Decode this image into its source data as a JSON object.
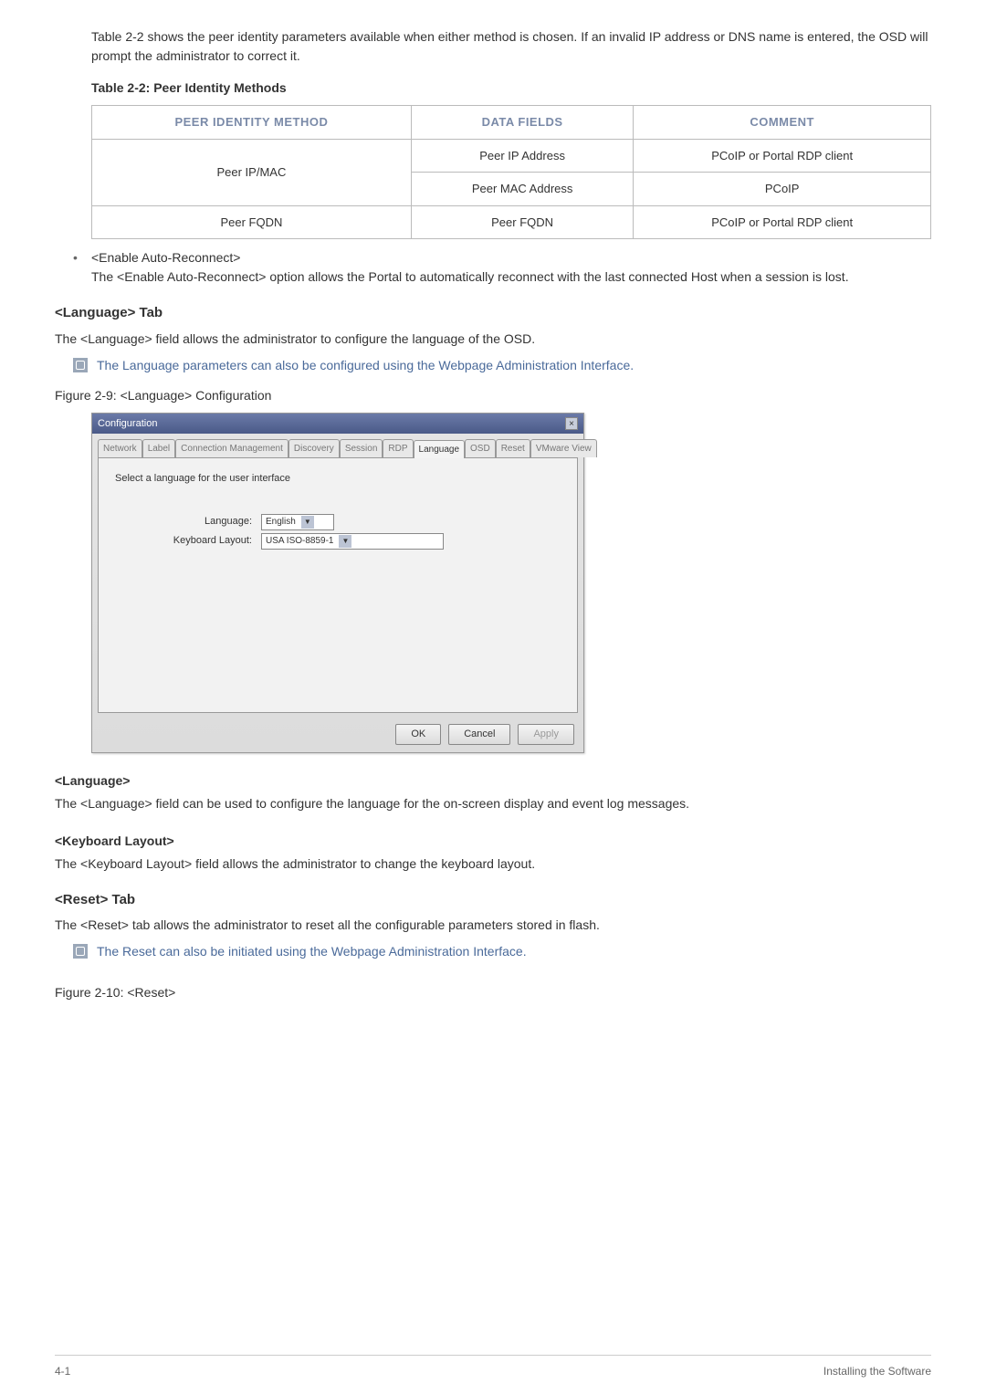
{
  "intro": "Table 2-2 shows the peer identity parameters available when either method is chosen. If an invalid IP address or DNS name is entered, the OSD will prompt the administrator to correct it.",
  "table_caption": "Table 2-2: Peer Identity Methods",
  "table": {
    "headers": [
      "PEER IDENTITY METHOD",
      "DATA FIELDS",
      "COMMENT"
    ],
    "rows": [
      {
        "method": "Peer IP/MAC",
        "field": "Peer IP Address",
        "comment": "PCoIP or Portal RDP client"
      },
      {
        "method": "",
        "field": "Peer MAC Address",
        "comment": "PCoIP"
      },
      {
        "method": "Peer FQDN",
        "field": "Peer FQDN",
        "comment": "PCoIP or Portal RDP client"
      }
    ]
  },
  "bullet": {
    "title": "<Enable Auto-Reconnect>",
    "body": "The <Enable Auto-Reconnect> option allows the Portal to automatically reconnect with the last connected Host when a session is lost."
  },
  "lang_tab": {
    "heading": "<Language> Tab",
    "desc": "The <Language> field allows the administrator to configure the language of the OSD.",
    "note": "The Language parameters can also be configured using the Webpage Administration Interface.",
    "figcap": "Figure 2-9: <Language> Configuration"
  },
  "dialog": {
    "title": "Configuration",
    "tabs": [
      "Network",
      "Label",
      "Connection Management",
      "Discovery",
      "Session",
      "RDP",
      "Language",
      "OSD",
      "Reset",
      "VMware View"
    ],
    "active_tab": "Language",
    "instruction": "Select a language for the user interface",
    "fields": {
      "language_label": "Language:",
      "language_value": "English",
      "keyboard_label": "Keyboard Layout:",
      "keyboard_value": "USA ISO-8859-1"
    },
    "buttons": {
      "ok": "OK",
      "cancel": "Cancel",
      "apply": "Apply"
    }
  },
  "language_section": {
    "heading": "<Language>",
    "body": "The <Language> field can be used to configure the language for the on-screen display and event log messages."
  },
  "keyboard_section": {
    "heading": "<Keyboard Layout>",
    "body": "The <Keyboard Layout> field allows the administrator to change the keyboard layout."
  },
  "reset_section": {
    "heading": "<Reset> Tab",
    "body": "The <Reset> tab allows the administrator to reset all the configurable parameters stored in flash.",
    "note": "The Reset can also be initiated using the Webpage Administration Interface.",
    "figcap": "Figure 2-10: <Reset>"
  },
  "footer": {
    "left": "4-1",
    "right": "Installing the Software"
  }
}
